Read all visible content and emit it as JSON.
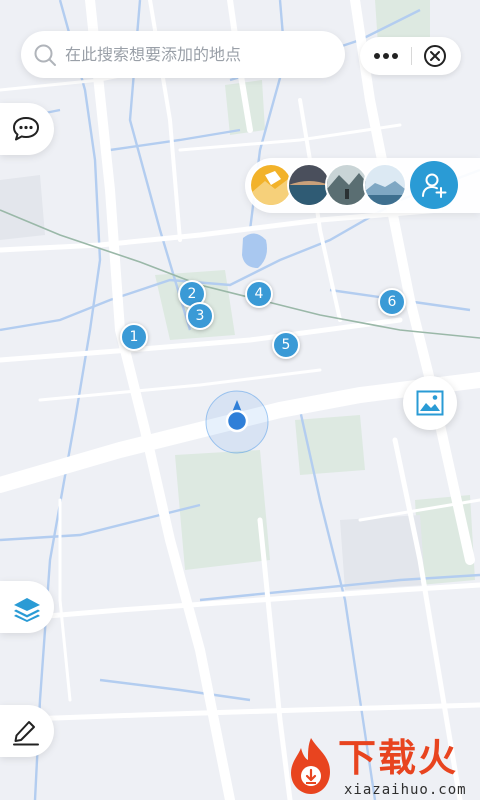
{
  "search": {
    "placeholder": "在此搜索想要添加的地点"
  },
  "capsule": {
    "more_icon": "more-dots-icon",
    "close_icon": "close-circle-icon"
  },
  "side_buttons": {
    "chat_icon": "chat-bubble-icon",
    "layers_icon": "layers-icon",
    "edit_icon": "pencil-icon"
  },
  "album": {
    "photos": [
      "photo-1",
      "photo-2",
      "photo-3",
      "photo-4"
    ],
    "add_icon": "add-person-icon"
  },
  "picture_button_icon": "image-icon",
  "markers": [
    {
      "label": "1"
    },
    {
      "label": "2"
    },
    {
      "label": "3"
    },
    {
      "label": "4"
    },
    {
      "label": "5"
    },
    {
      "label": "6"
    }
  ],
  "watermark": {
    "title": "下载火",
    "domain": "xiazaihuo.com"
  },
  "colors": {
    "accent": "#2a9bd5",
    "marker": "#3a9ad6",
    "map_background": "#eef0f5",
    "road": "#ffffff",
    "river": "#a9c8f0",
    "park": "#dbe9e0",
    "rail": "#8fb0a0",
    "watermark": "#e8441f"
  }
}
